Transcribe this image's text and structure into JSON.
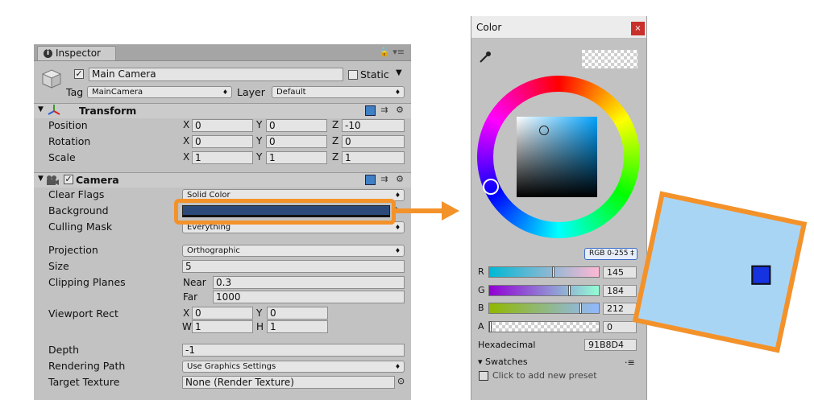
{
  "inspector": {
    "tab_label": "Inspector",
    "tab_icons": "🔒 ▾≡",
    "object": {
      "active": "✓",
      "name": "Main Camera",
      "static_label": "Static",
      "tag_label": "Tag",
      "tag_value": "MainCamera",
      "layer_label": "Layer",
      "layer_value": "Default"
    },
    "transform": {
      "title": "Transform",
      "position_label": "Position",
      "rotation_label": "Rotation",
      "scale_label": "Scale",
      "position": {
        "x": "0",
        "y": "0",
        "z": "-10"
      },
      "rotation": {
        "x": "0",
        "y": "0",
        "z": "0"
      },
      "scale": {
        "x": "1",
        "y": "1",
        "z": "1"
      }
    },
    "axis": {
      "x": "X",
      "y": "Y",
      "z": "Z",
      "w": "W",
      "h": "H"
    },
    "camera": {
      "enabled": "✓",
      "title": "Camera",
      "clear_flags_label": "Clear Flags",
      "clear_flags_value": "Solid Color",
      "background_label": "Background",
      "background_color": "#2b4a7a",
      "culling_mask_label": "Culling Mask",
      "culling_mask_value": "Everything",
      "projection_label": "Projection",
      "projection_value": "Orthographic",
      "size_label": "Size",
      "size_value": "5",
      "clipping_label": "Clipping Planes",
      "near_label": "Near",
      "near_value": "0.3",
      "far_label": "Far",
      "far_value": "1000",
      "viewport_label": "Viewport Rect",
      "viewport": {
        "x": "0",
        "y": "0",
        "w": "1",
        "h": "1"
      },
      "depth_label": "Depth",
      "depth_value": "-1",
      "rendering_path_label": "Rendering Path",
      "rendering_path_value": "Use Graphics Settings",
      "target_texture_label": "Target Texture",
      "target_texture_value": "None (Render Texture)"
    }
  },
  "color_window": {
    "title": "Color",
    "close": "×",
    "mode_label": "RGB 0-255 ‡",
    "r_label": "R",
    "r_value": "145",
    "g_label": "G",
    "g_value": "184",
    "b_label": "B",
    "b_value": "212",
    "a_label": "A",
    "a_value": "0",
    "hex_label": "Hexadecimal",
    "hex_value": "91B8D4",
    "swatches_label": "▾ Swatches",
    "swatches_menu": "·≡",
    "preset_label": "Click to add new preset"
  },
  "colors": {
    "highlight": "#f4922a",
    "preview_fill": "#a9d5f5",
    "preview_border": "#f4922a",
    "marker_fill": "#1533e0"
  }
}
